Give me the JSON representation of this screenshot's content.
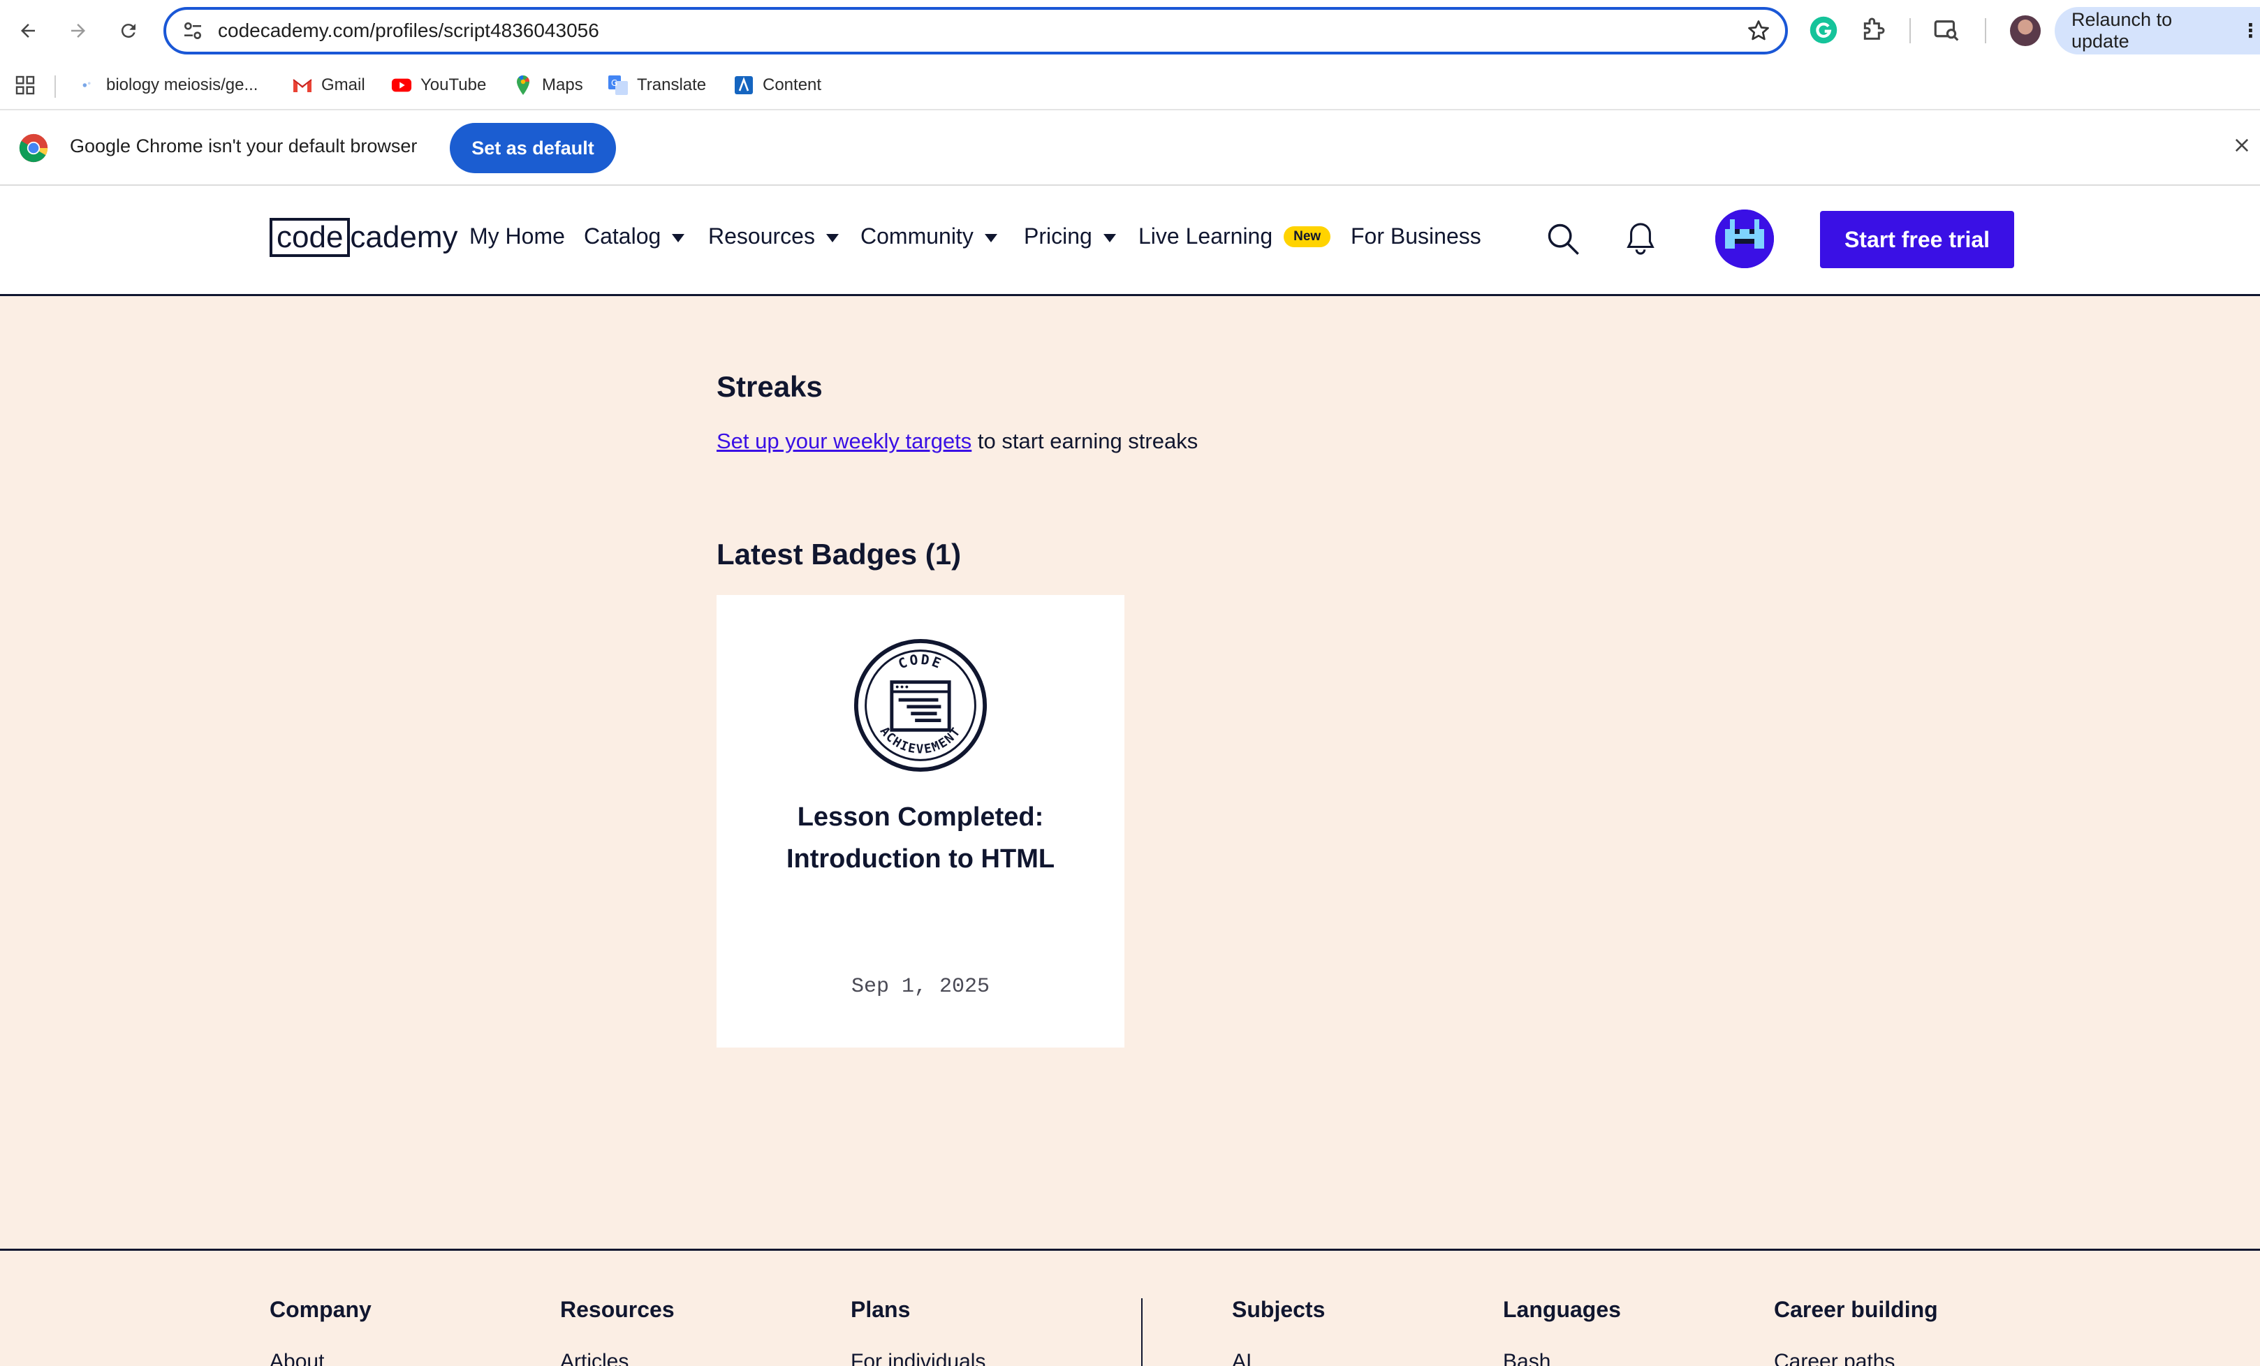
{
  "browser": {
    "url": "codecademy.com/profiles/script4836043056",
    "relaunch_label": "Relaunch to update",
    "bookmarks": [
      {
        "label": "biology meiosis/ge...",
        "icon": "site-icon"
      },
      {
        "label": "Gmail",
        "icon": "gmail-icon"
      },
      {
        "label": "YouTube",
        "icon": "youtube-icon"
      },
      {
        "label": "Maps",
        "icon": "maps-icon"
      },
      {
        "label": "Translate",
        "icon": "translate-icon"
      },
      {
        "label": "Content",
        "icon": "content-icon"
      }
    ],
    "infobar": {
      "message": "Google Chrome isn't your default browser",
      "button_label": "Set as default"
    }
  },
  "header": {
    "logo_boxed": "code",
    "logo_rest": "cademy",
    "nav": {
      "my_home": "My Home",
      "catalog": "Catalog",
      "resources": "Resources",
      "community": "Community",
      "pricing": "Pricing",
      "live_learning": "Live Learning",
      "new_badge": "New",
      "for_business": "For Business"
    },
    "cta_label": "Start free trial"
  },
  "streaks": {
    "title": "Streaks",
    "link_text": "Set up your weekly targets",
    "suffix_text": " to start earning streaks"
  },
  "badges": {
    "title": "Latest Badges (1)",
    "items": [
      {
        "title_line1": "Lesson Completed:",
        "title_line2": "Introduction to HTML",
        "date": "Sep 1, 2025",
        "emblem_top": "CODE",
        "emblem_bottom": "ACHIEVEMENT"
      }
    ]
  },
  "footer": {
    "columns": [
      {
        "heading": "Company",
        "first_link": "About"
      },
      {
        "heading": "Resources",
        "first_link": "Articles"
      },
      {
        "heading": "Plans",
        "first_link": "For individuals"
      },
      {
        "heading": "Subjects",
        "first_link": "AI"
      },
      {
        "heading": "Languages",
        "first_link": "Bash"
      },
      {
        "heading": "Career building",
        "first_link": "Career paths"
      }
    ]
  },
  "colors": {
    "brand": "#3a10e5",
    "page_bg": "#fbeee4",
    "text": "#10162f",
    "new_badge": "#ffd300",
    "chrome_blue": "#1b5dd1"
  }
}
